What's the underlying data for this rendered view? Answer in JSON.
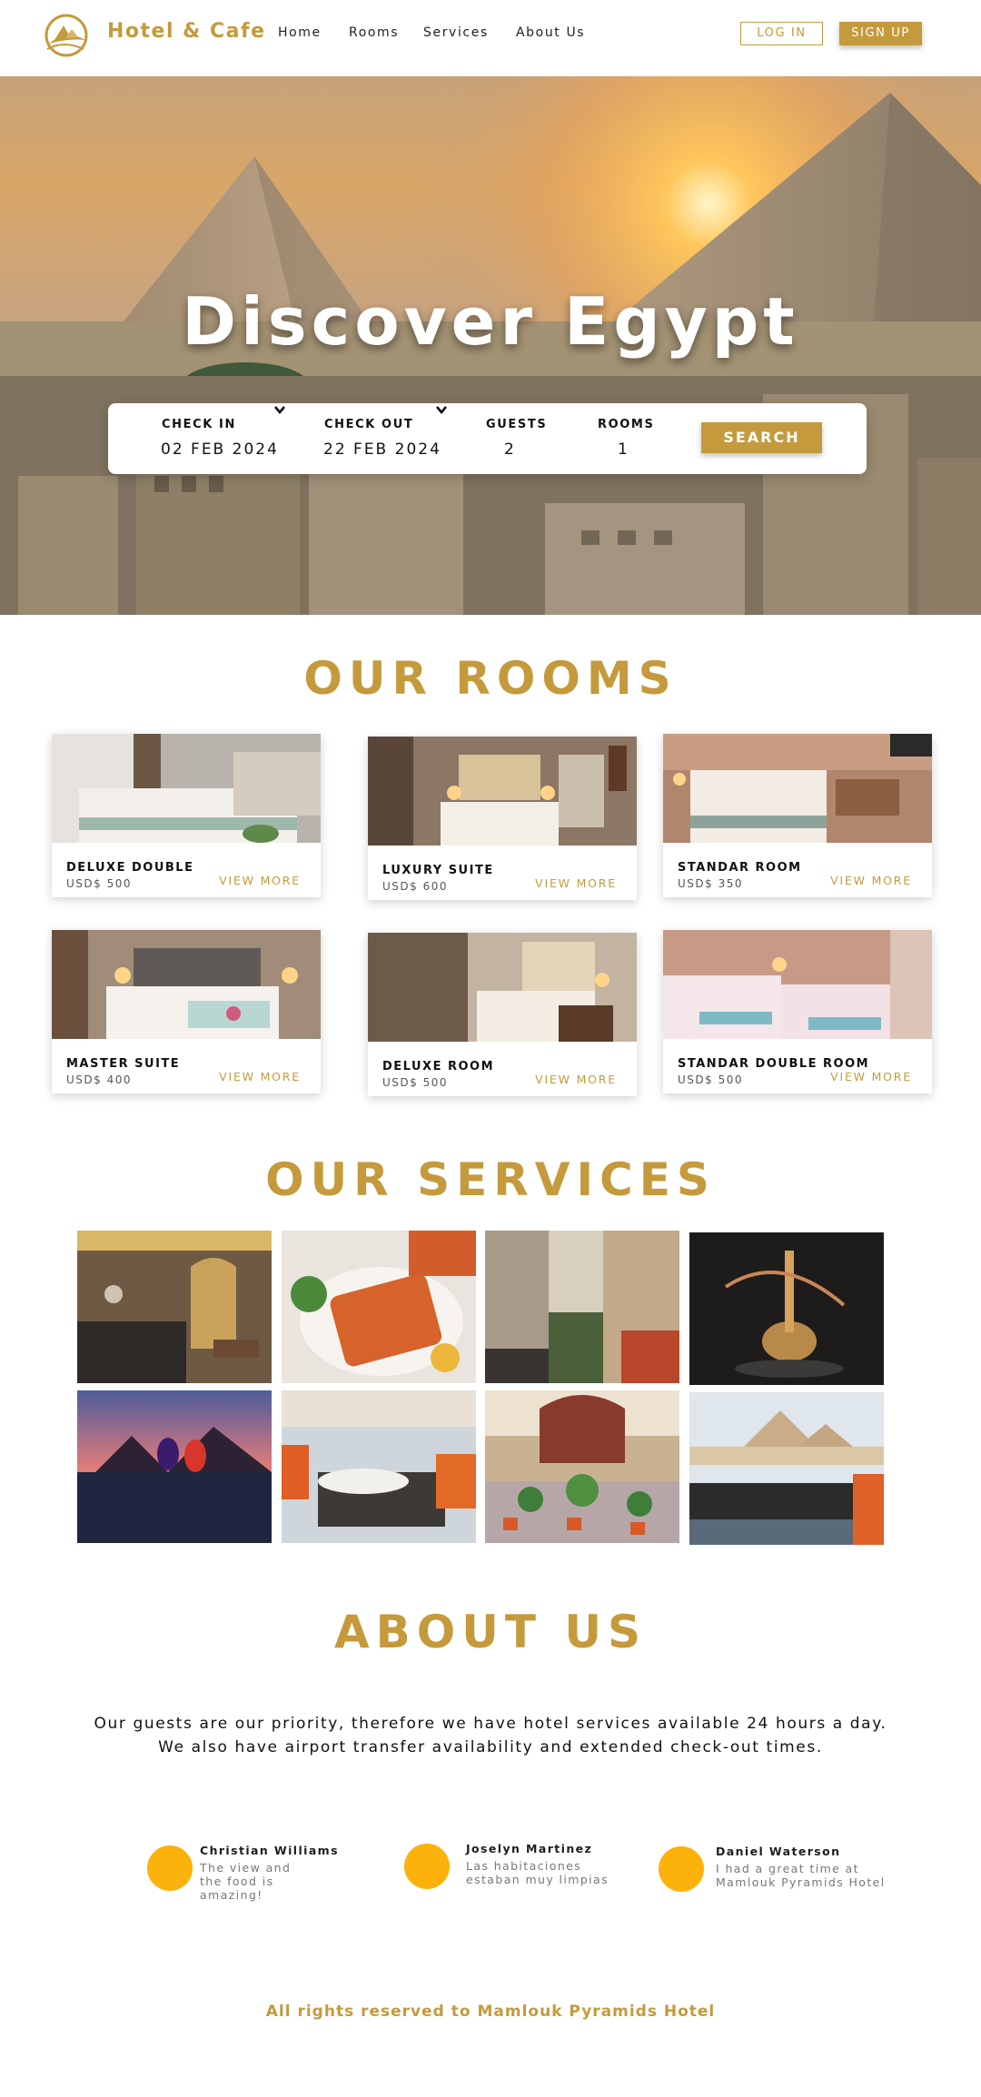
{
  "brand": {
    "name": "Hotel & Cafe",
    "accent": "#c49a3c"
  },
  "nav": {
    "links": [
      "Home",
      "Rooms",
      "Services",
      "About Us"
    ],
    "login": "LOG IN",
    "signup": "SIGN UP"
  },
  "hero": {
    "title": "Discover Egypt",
    "search": {
      "check_in": {
        "label": "CHECK IN",
        "value": "02 FEB 2024"
      },
      "check_out": {
        "label": "CHECK OUT",
        "value": "22 FEB 2024"
      },
      "guests": {
        "label": "GUESTS",
        "value": "2"
      },
      "rooms": {
        "label": "ROOMS",
        "value": "1"
      },
      "button": "SEARCH"
    }
  },
  "rooms": {
    "title": "OUR ROOMS",
    "items": [
      {
        "name": "DELUXE DOUBLE",
        "price": "USD$ 500",
        "action": "VIEW MORE"
      },
      {
        "name": "LUXURY SUITE",
        "price": "USD$ 600",
        "action": "VIEW MORE"
      },
      {
        "name": "STANDAR ROOM",
        "price": "USD$ 350",
        "action": "VIEW MORE"
      },
      {
        "name": "MASTER SUITE",
        "price": "USD$ 400",
        "action": "VIEW MORE"
      },
      {
        "name": "DELUXE ROOM",
        "price": "USD$ 500",
        "action": "VIEW MORE"
      },
      {
        "name": "STANDAR DOUBLE ROOM",
        "price": "USD$ 500",
        "action": "VIEW MORE"
      }
    ]
  },
  "services": {
    "title": "OUR SERVICES"
  },
  "about": {
    "title": "ABOUT US",
    "line1": "Our guests are our priority, therefore we have hotel services available 24 hours a day.",
    "line2": "We also have airport transfer availability and extended check-out times."
  },
  "reviews": [
    {
      "name": "Christian Williams",
      "text": "The view and the food is amazing!"
    },
    {
      "name": "Joselyn Martinez",
      "text": "Las habitaciones estaban muy limpias"
    },
    {
      "name": "Daniel Waterson",
      "text": "I had a great time at Mamlouk Pyramids Hotel"
    }
  ],
  "footer": {
    "text": "All rights reserved to Mamlouk Pyramids Hotel"
  }
}
